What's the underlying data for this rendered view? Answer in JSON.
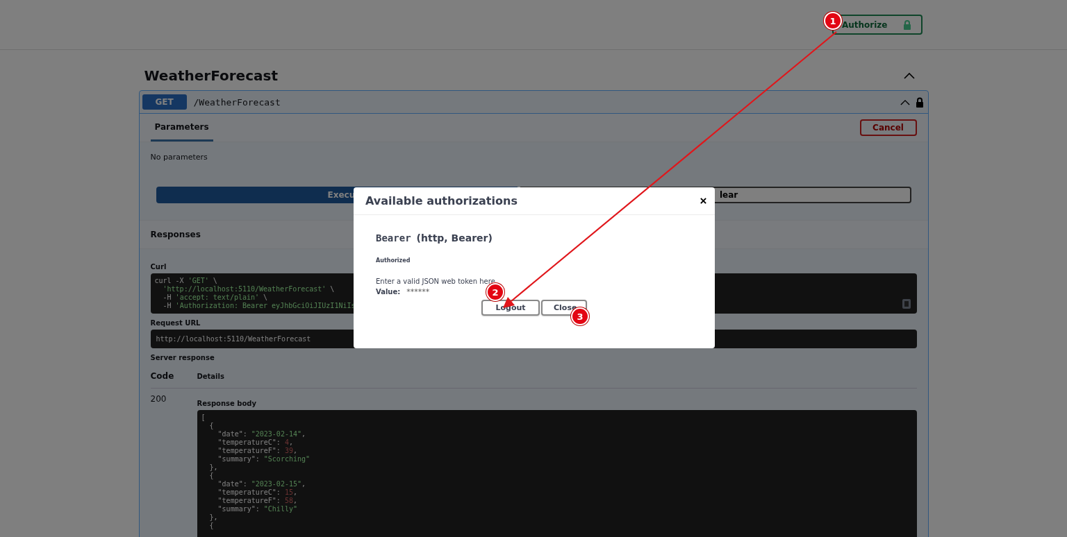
{
  "topbar": {
    "authorize_button": "Authorize"
  },
  "section": {
    "title": "WeatherForecast",
    "expanded": true
  },
  "operation": {
    "method": "GET",
    "path": "/WeatherForecast",
    "expanded": true,
    "locked": true,
    "tabs": [
      {
        "label": "Parameters",
        "selected": true
      }
    ],
    "cancel_button": "Cancel",
    "no_parameters": "No parameters",
    "execute_button": "Execu",
    "clear_button": "lear",
    "responses_title": "Responses",
    "curl_label": "Curl",
    "curl_lines": [
      [
        {
          "kind": "plain",
          "text": "curl -X "
        },
        {
          "kind": "string",
          "text": "'GET'"
        },
        {
          "kind": "plain",
          "text": " \\"
        }
      ],
      [
        {
          "kind": "string",
          "text": "  'http://localhost:5110/WeatherForecast'"
        },
        {
          "kind": "plain",
          "text": " \\"
        }
      ],
      [
        {
          "kind": "plain",
          "text": "  -H "
        },
        {
          "kind": "string",
          "text": "'accept: text/plain'"
        },
        {
          "kind": "plain",
          "text": " \\"
        }
      ],
      [
        {
          "kind": "plain",
          "text": "  -H "
        },
        {
          "kind": "string",
          "text": "'Authorization: Bearer eyJhbGciOiJIUzI1NiIs"
        }
      ]
    ],
    "request_url_label": "Request URL",
    "request_url": "http://localhost:5110/WeatherForecast",
    "server_response_label": "Server response",
    "columns": [
      "Code",
      "Details"
    ],
    "code": "200",
    "response_body_label": "Response body",
    "response_body": [
      [
        {
          "kind": "plain",
          "text": "["
        }
      ],
      [
        {
          "kind": "plain",
          "text": "  {"
        }
      ],
      [
        {
          "kind": "plain",
          "text": "    \"date\": "
        },
        {
          "kind": "string",
          "text": "\"2023-02-14\""
        },
        {
          "kind": "plain",
          "text": ","
        }
      ],
      [
        {
          "kind": "plain",
          "text": "    \"temperatureC\": "
        },
        {
          "kind": "number",
          "text": "4"
        },
        {
          "kind": "plain",
          "text": ","
        }
      ],
      [
        {
          "kind": "plain",
          "text": "    \"temperatureF\": "
        },
        {
          "kind": "number",
          "text": "39"
        },
        {
          "kind": "plain",
          "text": ","
        }
      ],
      [
        {
          "kind": "plain",
          "text": "    \"summary\": "
        },
        {
          "kind": "string",
          "text": "\"Scorching\""
        }
      ],
      [
        {
          "kind": "plain",
          "text": "  },"
        }
      ],
      [
        {
          "kind": "plain",
          "text": "  {"
        }
      ],
      [
        {
          "kind": "plain",
          "text": "    \"date\": "
        },
        {
          "kind": "string",
          "text": "\"2023-02-15\""
        },
        {
          "kind": "plain",
          "text": ","
        }
      ],
      [
        {
          "kind": "plain",
          "text": "    \"temperatureC\": "
        },
        {
          "kind": "number",
          "text": "15"
        },
        {
          "kind": "plain",
          "text": ","
        }
      ],
      [
        {
          "kind": "plain",
          "text": "    \"temperatureF\": "
        },
        {
          "kind": "number",
          "text": "58"
        },
        {
          "kind": "plain",
          "text": ","
        }
      ],
      [
        {
          "kind": "plain",
          "text": "    \"summary\": "
        },
        {
          "kind": "string",
          "text": "\"Chilly\""
        }
      ],
      [
        {
          "kind": "plain",
          "text": "  },"
        }
      ],
      [
        {
          "kind": "plain",
          "text": "  {"
        }
      ]
    ]
  },
  "dialog": {
    "title": "Available authorizations",
    "scheme_name": "Bearer",
    "scheme_type": "(http, Bearer)",
    "status": "Authorized",
    "description": "Enter a valid JSON web token here",
    "value_label": "Value:",
    "value": "******",
    "buttons": [
      {
        "label": "Logout"
      },
      {
        "label": "Close"
      }
    ]
  },
  "annotations": [
    {
      "label": "1"
    },
    {
      "label": "2"
    },
    {
      "label": "3"
    }
  ]
}
